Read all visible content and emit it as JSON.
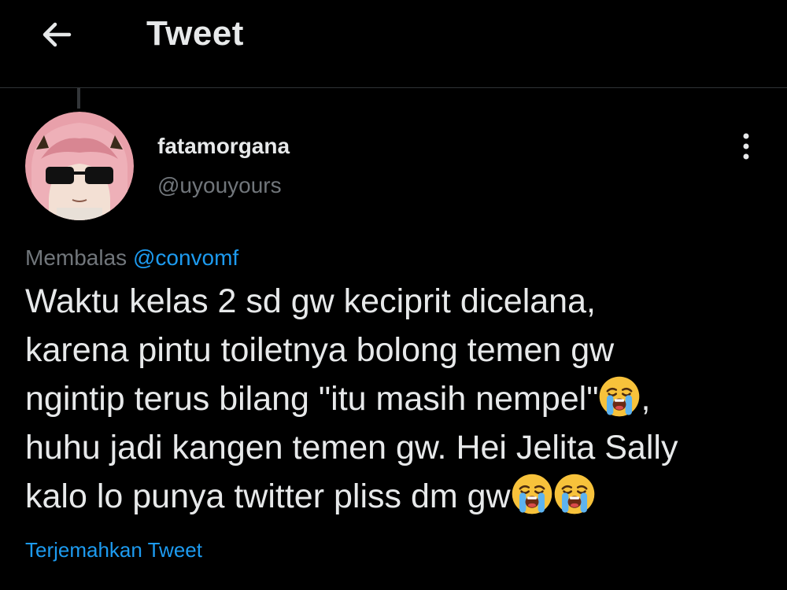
{
  "header": {
    "title": "Tweet",
    "back_icon": "arrow-left-icon"
  },
  "tweet": {
    "author": {
      "name": "fatamorgana",
      "handle": "@uyouyours"
    },
    "more_icon": "more-vertical-icon",
    "reply": {
      "prefix": "Membalas",
      "handle": "@convomf"
    },
    "text_lines": [
      "Waktu kelas 2 sd gw keciprit dicelana,",
      "karena pintu toiletnya bolong temen gw",
      "ngintip terus bilang \"itu masih nempel\"",
      "huhu jadi kangen temen gw. Hei Jelita Sally",
      "kalo lo punya twitter pliss dm gw"
    ],
    "line3_suffix": ",",
    "emoji": "loudly-crying-face",
    "translate_label": "Terjemahkan Tweet"
  },
  "colors": {
    "background": "#000000",
    "text": "#e7e9ea",
    "secondary_text": "#71767b",
    "accent": "#1d9bf0"
  }
}
